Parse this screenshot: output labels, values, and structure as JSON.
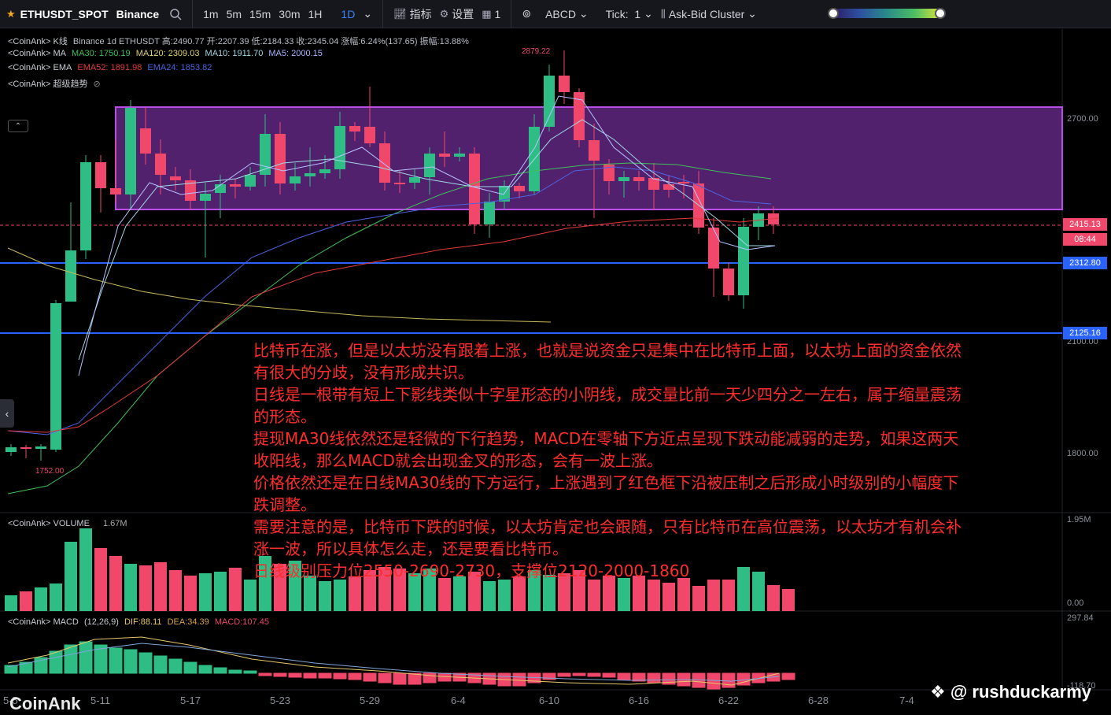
{
  "toolbar": {
    "symbol": "ETHUSDT_SPOT",
    "exchange": "Binance",
    "timeframes": [
      "1m",
      "5m",
      "15m",
      "30m",
      "1H",
      "1D"
    ],
    "active_timeframe": "1D",
    "indicators_label": "指标",
    "settings_label": "设置",
    "layout_count": "1",
    "drawing_label": "ABCD",
    "tick_label": "Tick:",
    "tick_value": "1",
    "cluster_label": "Ask-Bid Cluster"
  },
  "legend": {
    "kline": {
      "prefix": "<CoinAnk> K线",
      "text": "Binance 1d ETHUSDT 高:2490.77 开:2207.39 低:2184.33 收:2345.04 涨幅:6.24%(137.65) 振幅:13.88%"
    },
    "ma": {
      "prefix": "<CoinAnk> MA",
      "ma30": "MA30: 1750.19",
      "ma120": "MA120: 2309.03",
      "ma10": "MA10: 1911.70",
      "ma5": "MA5: 2000.15"
    },
    "ema": {
      "prefix": "<CoinAnk> EMA",
      "ema52": "EMA52: 1891.98",
      "ema24": "EMA24: 1853.82"
    },
    "trend": {
      "prefix": "<CoinAnk> 超级趋势"
    },
    "volume": {
      "prefix": "<CoinAnk> VOLUME",
      "value": "1.67M"
    },
    "macd": {
      "prefix": "<CoinAnk> MACD",
      "params": "(12,26,9)",
      "dif": "DIF:88.11",
      "dea": "DEA:34.39",
      "macd": "MACD:107.45"
    }
  },
  "price_axis": {
    "ticks": [
      "2700.00",
      "2100.00",
      "1800.00"
    ],
    "current_price": "2415.13",
    "countdown": "08:44",
    "line1": "2312.80",
    "line2": "2125.16",
    "high_marker": "2879.22",
    "low_marker": "1752.00"
  },
  "volume_axis": {
    "top": "1.95M",
    "bottom": "0.00"
  },
  "macd_axis": {
    "top": "297.84",
    "bottom": "-118.70"
  },
  "dates": [
    "5-5",
    "5-11",
    "5-17",
    "5-23",
    "5-29",
    "6-4",
    "6-10",
    "6-16",
    "6-22",
    "6-28",
    "7-4"
  ],
  "annotation": [
    "比特币在涨，但是以太坊没有跟着上涨，也就是说资金只是集中在比特币上面，以太坊上面的资金依然",
    "有很大的分歧，没有形成共识。",
    "日线是一根带有短上下影线类似十字星形态的小阴线，成交量比前一天少四分之一左右，属于缩量震荡",
    "的形态。",
    "提现MA30线依然还是轻微的下行趋势，MACD在零轴下方近点呈现下跌动能减弱的走势，如果这两天",
    "收阳线，那么MACD就会出现金叉的形态，会有一波上涨。",
    "价格依然还是在日线MA30线的下方运行，上涨遇到了红色框下沿被压制之后形成小时级别的小幅度下",
    "跌调整。",
    "需要注意的是，比特币下跌的时候，以太坊肯定也会跟随，只有比特币在高位震荡，以太坊才有机会补",
    "涨一波，所以具体怎么走，还是要看比特币。",
    "日线级别压力位2550-2690-2730，支撑位2120-2000-1860"
  ],
  "brand": "CoinAnk",
  "watermark": "@ rushduckarmy",
  "colors": {
    "up": "#2ebd85",
    "down": "#f0476a",
    "accent": "#3b82f6",
    "box": "#b74ee6"
  }
}
